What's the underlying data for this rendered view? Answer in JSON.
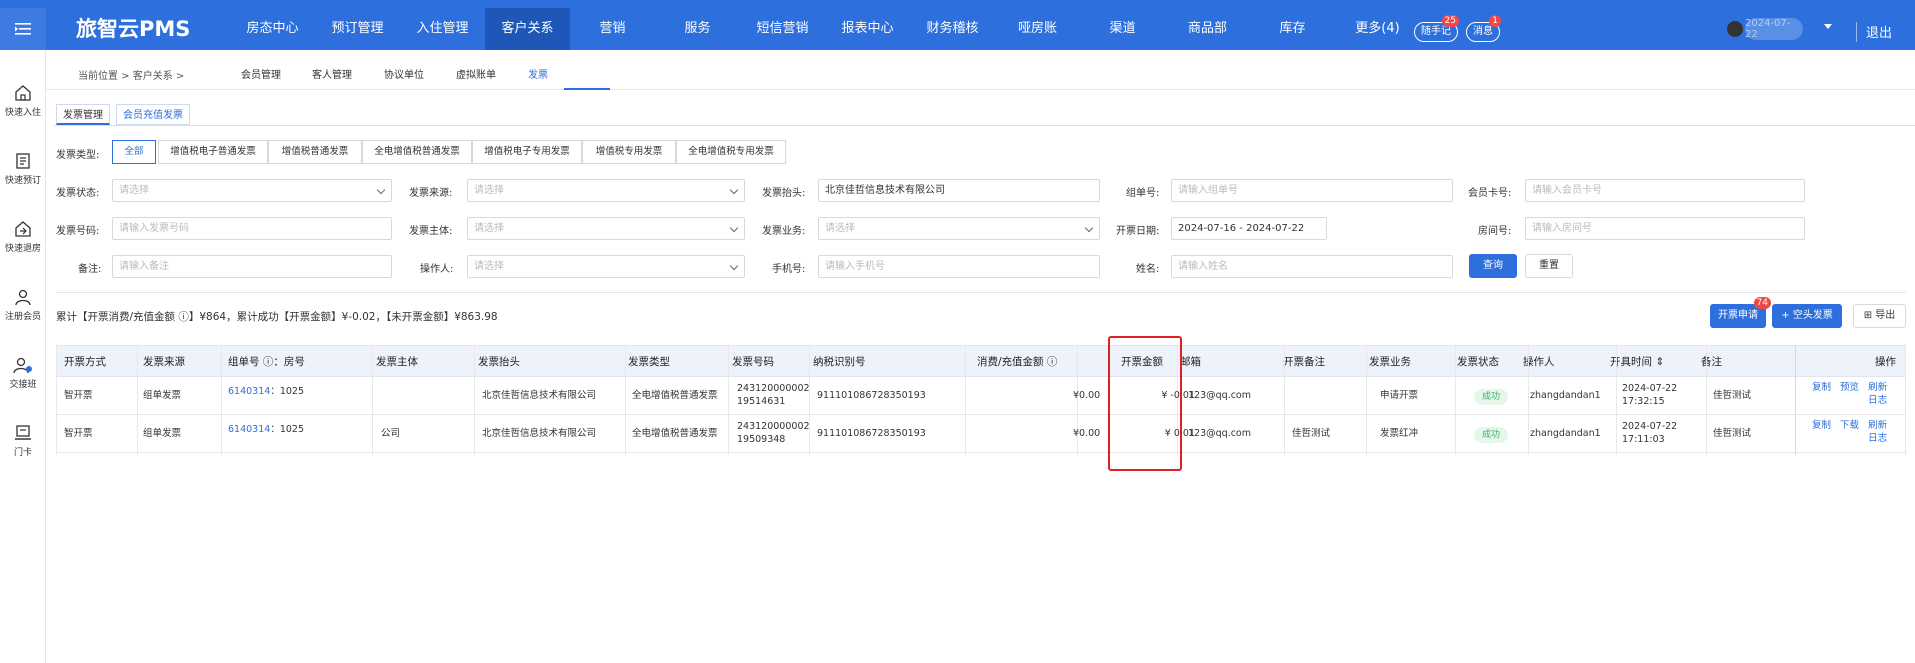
{
  "topbar": {
    "brand": "旅智云PMS",
    "nav": [
      "房态中心",
      "预订管理",
      "入住管理",
      "客户关系",
      "营销",
      "服务",
      "短信营销",
      "报表中心",
      "财务稽核",
      "哑房账",
      "渠道",
      "商品部",
      "库存",
      "更多(4)"
    ],
    "active_nav": "客户关系",
    "notes_label": "随手记",
    "notes_count": "25",
    "msg_label": "消息",
    "msg_count": "1",
    "user_date": "2024-07-22",
    "logout": "退出"
  },
  "sidebar": [
    "快速入住",
    "快速预订",
    "快速退房",
    "注册会员",
    "交接班",
    "门卡"
  ],
  "subnav": {
    "crumb": "当前位置 > 客户关系 >",
    "tabs": [
      "会员管理",
      "客人管理",
      "协议单位",
      "虚拟账单",
      "发票"
    ],
    "active": "发票"
  },
  "tabs2": [
    "发票管理",
    "会员充值发票"
  ],
  "filters": {
    "type_label": "发票类型:",
    "types": [
      "全部",
      "增值税电子普通发票",
      "增值税普通发票",
      "全电增值税普通发票",
      "增值税电子专用发票",
      "增值税专用发票",
      "全电增值税专用发票"
    ],
    "status_label": "发票状态:",
    "status_ph": "请选择",
    "source_label": "发票来源:",
    "source_ph": "请选择",
    "title_label": "发票抬头:",
    "title_value": "北京佳哲信息技术有限公司",
    "group_label": "组单号:",
    "group_ph": "请输入组单号",
    "member_label": "会员卡号:",
    "member_ph": "请输入会员卡号",
    "number_label": "发票号码:",
    "number_ph": "请输入发票号码",
    "subject_label": "发票主体:",
    "subject_ph": "请选择",
    "biz_label": "发票业务:",
    "biz_ph": "请选择",
    "date_label": "开票日期:",
    "date_value": "2024-07-16 - 2024-07-22",
    "room_label": "房间号:",
    "room_ph": "请输入房间号",
    "remark_label": "备注:",
    "remark_ph": "请输入备注",
    "operator_label": "操作人:",
    "operator_ph": "请选择",
    "phone_label": "手机号:",
    "phone_ph": "请输入手机号",
    "name_label": "姓名:",
    "name_ph": "请输入姓名",
    "query": "查询",
    "reset": "重置"
  },
  "summary": "累计【开票消费/充值金额 ⓘ】¥864，累计成功【开票金额】¥-0.02，【未开票金额】¥863.98",
  "actions": {
    "apply": "开票申请",
    "apply_badge": "74",
    "blank": "+ 空头发票",
    "export": "导出"
  },
  "table": {
    "headers": [
      "开票方式",
      "发票来源",
      "组单号 ⓘ：房号",
      "发票主体",
      "发票抬头",
      "发票类型",
      "发票号码",
      "纳税识别号",
      "消费/充值金额 ⓘ",
      "开票金额",
      "邮箱",
      "开票备注",
      "发票业务",
      "发票状态",
      "操作人",
      "开具时间 ⇕",
      "备注",
      "操作"
    ],
    "rows": [
      {
        "mode": "智开票",
        "source": "组单发票",
        "group": "6140314",
        "room": "：1025",
        "subject": "",
        "title": "北京佳哲信息技术有限公司",
        "type": "全电增值税普通发票",
        "num1": "243120000002",
        "num2": "19514631",
        "tax": "911101086728350193",
        "consume": "¥0.00",
        "amount": "¥ -0.01",
        "email": "123@qq.com",
        "note": "",
        "biz": "申请开票",
        "status": "成功",
        "operator": "zhangdandan1",
        "date": "2024-07-22",
        "time": "17:32:15",
        "remark": "佳哲测试",
        "ops": [
          "复制",
          "预览",
          "刷新",
          "日志"
        ]
      },
      {
        "mode": "智开票",
        "source": "组单发票",
        "group": "6140314",
        "room": "：1025",
        "subject": "公司",
        "title": "北京佳哲信息技术有限公司",
        "type": "全电增值税普通发票",
        "num1": "243120000002",
        "num2": "19509348",
        "tax": "911101086728350193",
        "consume": "¥0.00",
        "amount": "¥ 0.01",
        "email": "123@qq.com",
        "note": "佳哲测试",
        "biz": "发票红冲",
        "status": "成功",
        "operator": "zhangdandan1",
        "date": "2024-07-22",
        "time": "17:11:03",
        "remark": "佳哲测试",
        "ops": [
          "复制",
          "下载",
          "刷新",
          "日志"
        ]
      }
    ]
  }
}
